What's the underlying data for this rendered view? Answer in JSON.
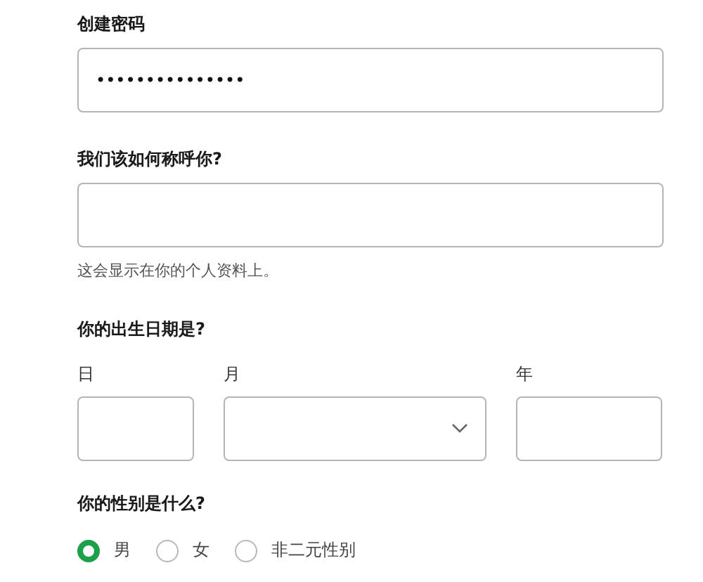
{
  "password": {
    "label": "创建密码",
    "value": "•••••••••••••••"
  },
  "name": {
    "label": "我们该如何称呼你?",
    "hint": "这会显示在你的个人资料上。"
  },
  "birthdate": {
    "label": "你的出生日期是?",
    "fields": [
      {
        "label": "日",
        "kind": "text"
      },
      {
        "label": "月",
        "kind": "select"
      },
      {
        "label": "年",
        "kind": "text"
      }
    ]
  },
  "gender": {
    "label": "你的性别是什么?",
    "options": [
      {
        "label": "男",
        "selected": true
      },
      {
        "label": "女",
        "selected": false
      },
      {
        "label": "非二元性别",
        "selected": false
      }
    ]
  }
}
